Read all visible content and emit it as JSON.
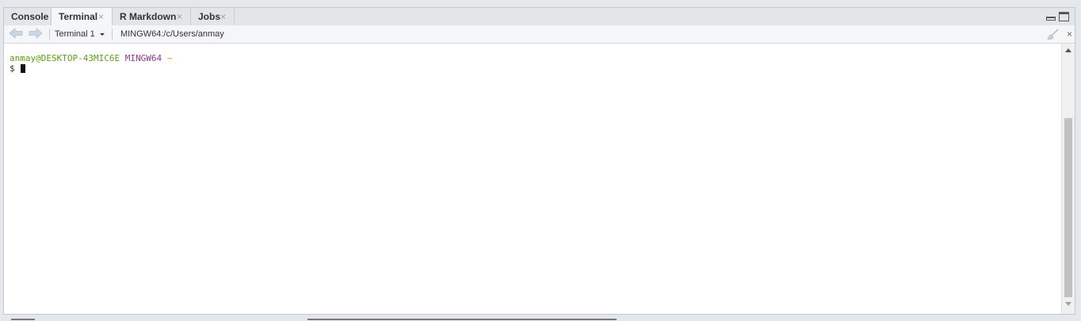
{
  "tabs": [
    {
      "label": "Console",
      "closable": false,
      "active": false
    },
    {
      "label": "Terminal",
      "closable": true,
      "active": true
    },
    {
      "label": "R Markdown",
      "closable": true,
      "active": false
    },
    {
      "label": "Jobs",
      "closable": true,
      "active": false
    }
  ],
  "close_glyph": "×",
  "toolbar": {
    "terminal_selector": "Terminal 1",
    "path": "MINGW64:/c/Users/anmay",
    "close_label": "×"
  },
  "terminal": {
    "user_host": "anmay@DESKTOP-43MIC6E",
    "system": "MINGW64",
    "cwd": "~",
    "prompt": "$"
  },
  "colors": {
    "user_host": "#5e9e1a",
    "system": "#8c3c8c",
    "cwd": "#b59e1a"
  },
  "icons": [
    "back-arrow-icon",
    "forward-arrow-icon",
    "dropdown-caret-icon",
    "broom-icon",
    "minimize-icon",
    "maximize-icon"
  ]
}
